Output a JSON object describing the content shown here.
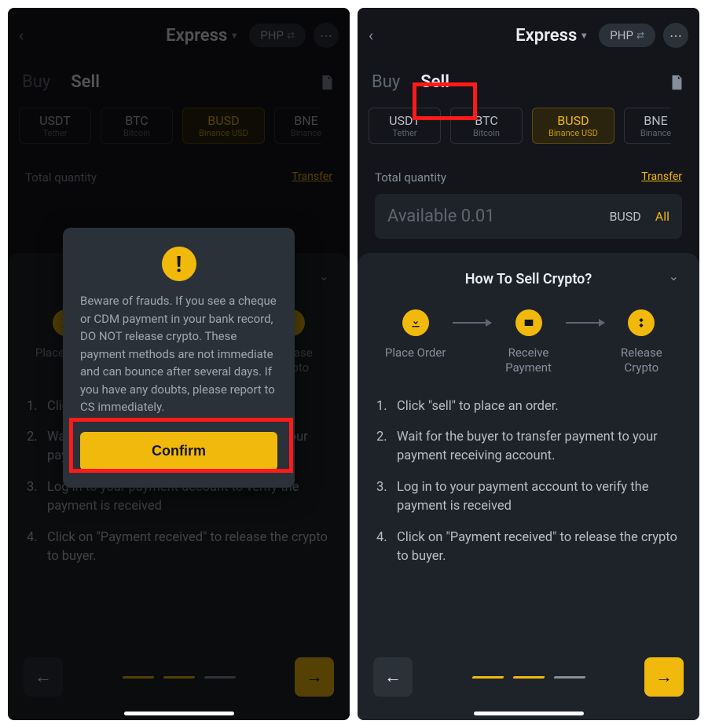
{
  "header": {
    "express_label": "Express",
    "currency_label": "PHP"
  },
  "tabs": {
    "buy": "Buy",
    "sell": "Sell"
  },
  "cryptos": [
    {
      "sym": "USDT",
      "sub": "Tether",
      "active": false
    },
    {
      "sym": "BTC",
      "sub": "Bitcoin",
      "active": false
    },
    {
      "sym": "BUSD",
      "sub": "Binance USD",
      "active": true
    },
    {
      "sym": "BNB",
      "sub": "Binance",
      "active": false,
      "trunc_sym": "BNE",
      "trunc_sub": "Binance"
    }
  ],
  "quantity": {
    "label": "Total quantity",
    "transfer": "Transfer",
    "available": "Available 0.01",
    "symbol": "BUSD",
    "all": "All"
  },
  "panel": {
    "title": "How To Sell Crypto?",
    "steps": [
      {
        "label": "Place Order"
      },
      {
        "label": "Receive Payment"
      },
      {
        "label": "Release Crypto"
      }
    ],
    "instructions": [
      "Click \"sell\" to place an order.",
      "Wait for the buyer to transfer payment to your payment receiving account.",
      "Log in to your payment account to verify the payment is received",
      "Click on \"Payment received\" to release the crypto to buyer."
    ]
  },
  "modal": {
    "text": "Beware of frauds. If you see a cheque or CDM payment in your bank record, DO NOT release crypto. These payment methods are not immediate and can bounce after several days. If you have any doubts, please report to CS immediately.",
    "confirm": "Confirm"
  }
}
